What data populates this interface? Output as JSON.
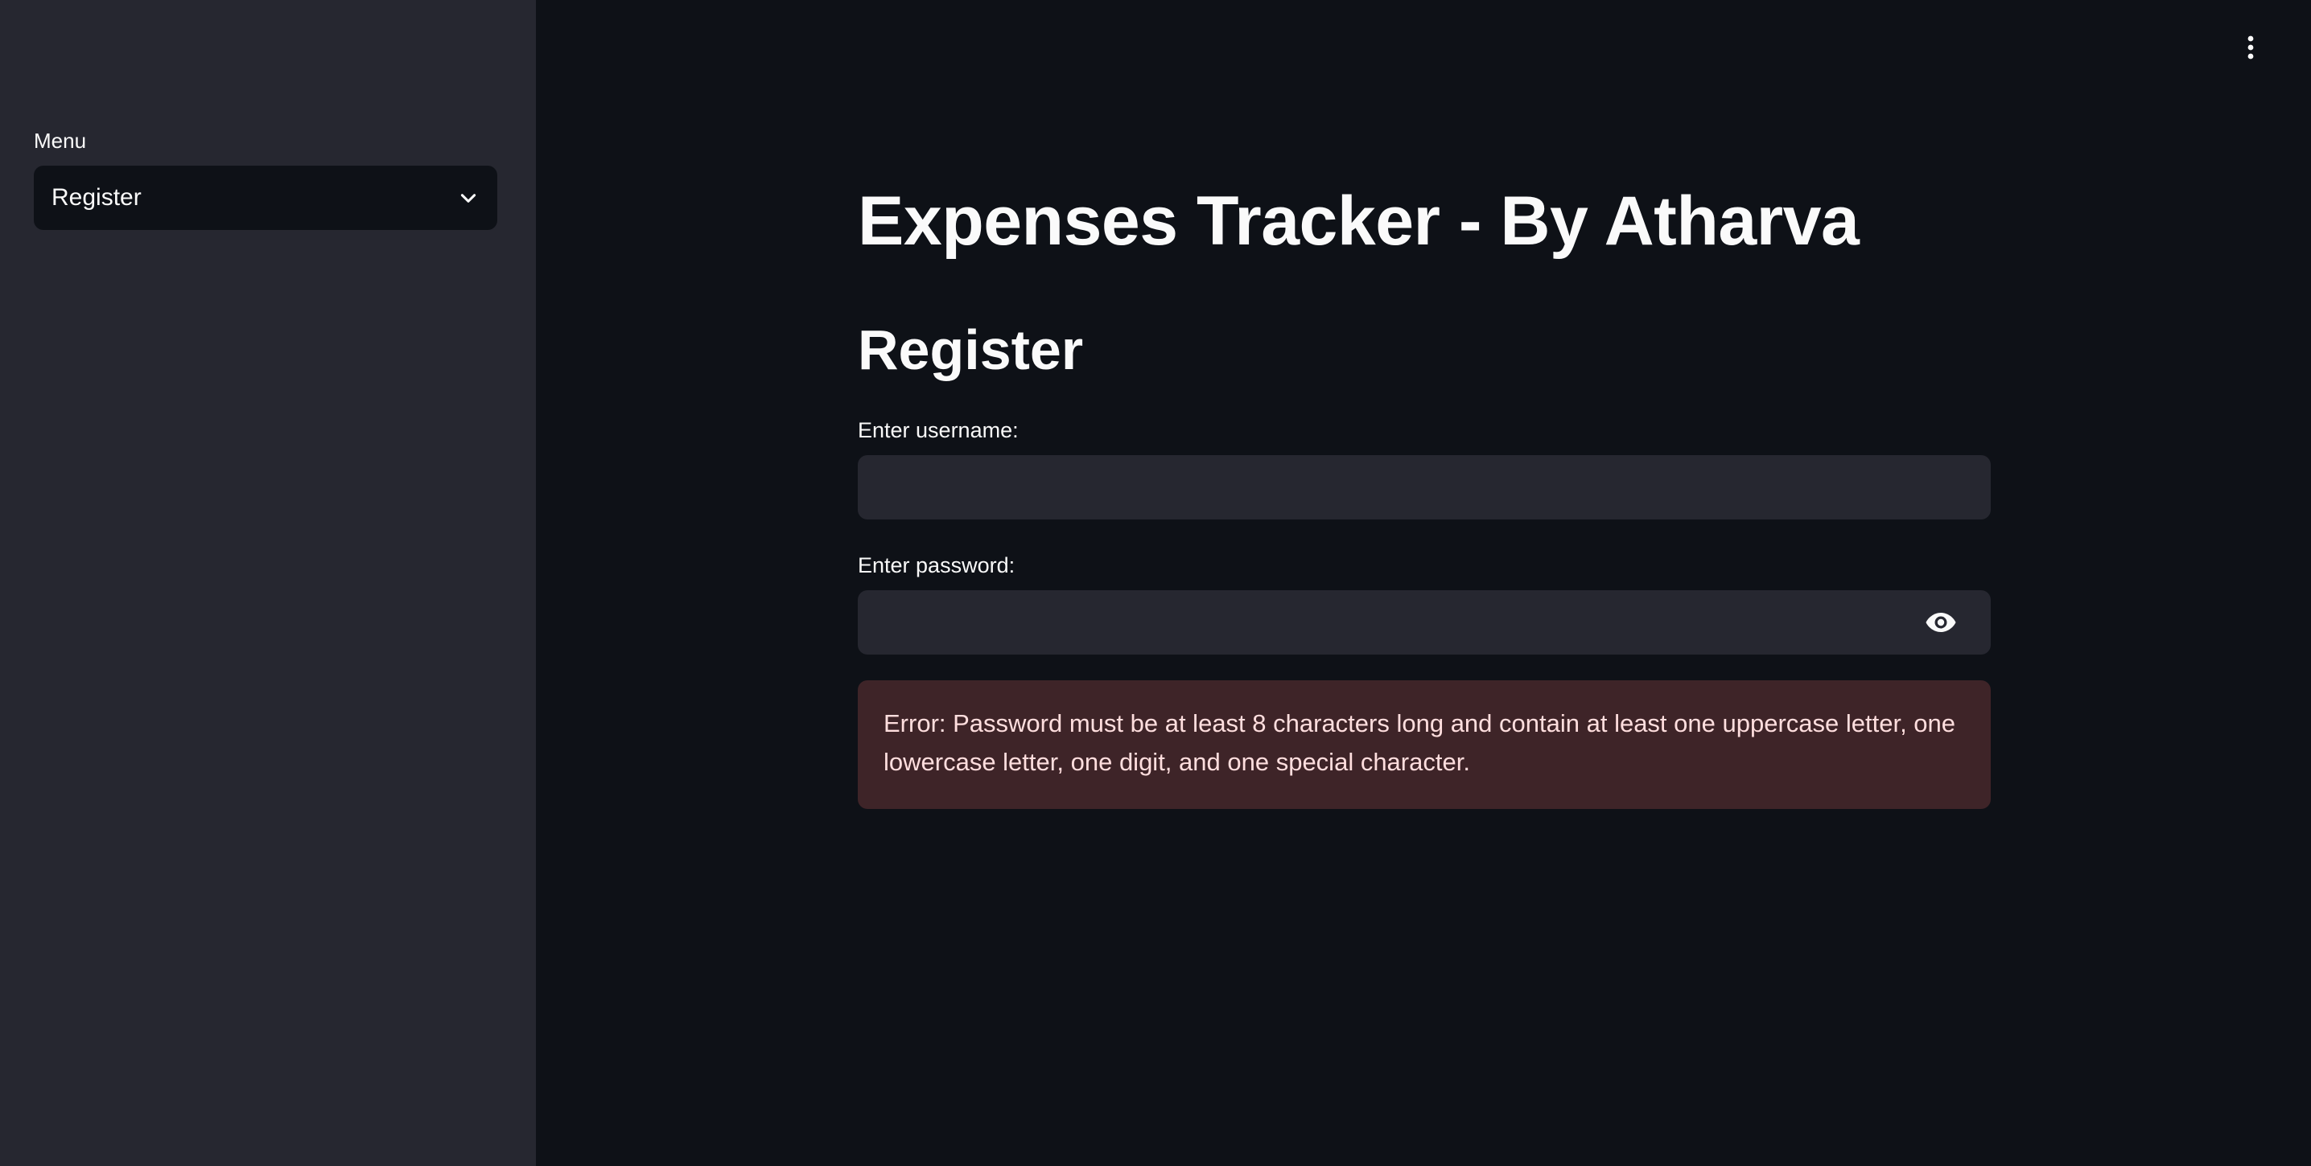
{
  "sidebar": {
    "menu_label": "Menu",
    "menu_selected": "Register",
    "menu_options": [
      "Register"
    ]
  },
  "main": {
    "title": "Expenses Tracker - By Atharva",
    "heading": "Register",
    "username": {
      "label": "Enter username:",
      "value": "",
      "placeholder": ""
    },
    "password": {
      "label": "Enter password:",
      "value": "",
      "placeholder": ""
    },
    "error_message": "Error: Password must be at least 8 characters long and contain at least one uppercase letter, one lowercase letter, one digit, and one special character."
  },
  "icons": {
    "menu": "three-dots-vertical-icon",
    "select": "chevron-down-icon",
    "password_toggle": "eye-icon"
  },
  "colors": {
    "background": "#0e1117",
    "sidebar": "#262730",
    "input": "#262730",
    "error_background": "#3e2428",
    "error_text": "#ffdede",
    "text": "#fafafa"
  }
}
